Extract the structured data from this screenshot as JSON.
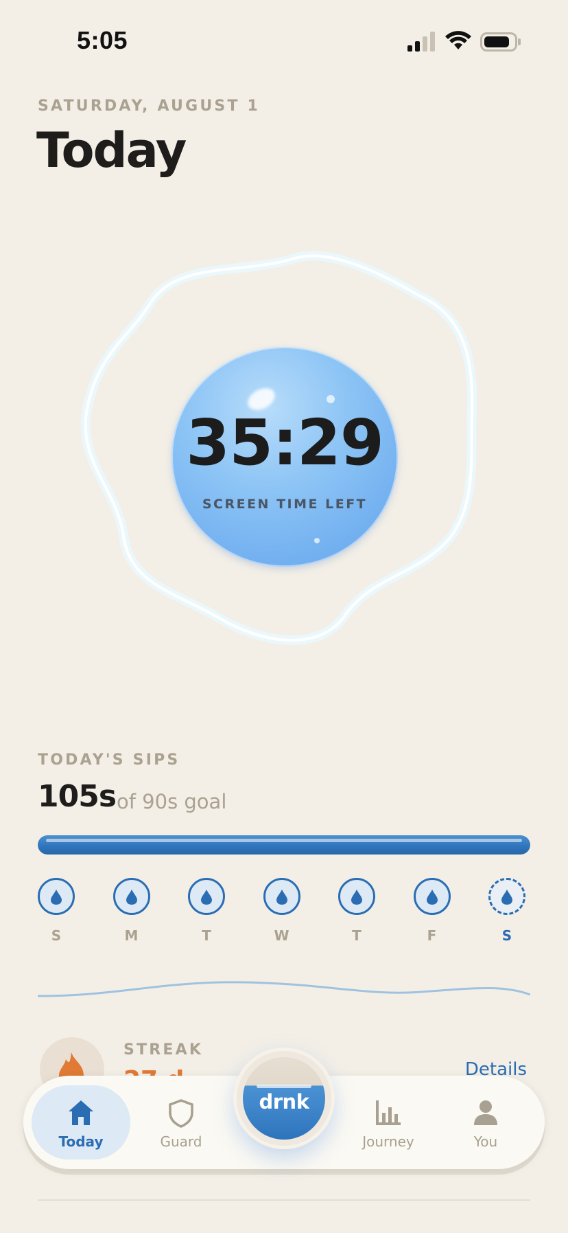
{
  "status_bar": {
    "time": "5:05"
  },
  "header": {
    "date": "SATURDAY, AUGUST 1",
    "title": "Today"
  },
  "timer": {
    "value": "35:29",
    "caption": "SCREEN TIME LEFT"
  },
  "sips": {
    "label": "TODAY'S SIPS",
    "value": "105s",
    "goal_text": "of 90s goal",
    "progress_fraction": 1.0
  },
  "week": [
    {
      "letter": "S",
      "state": "done"
    },
    {
      "letter": "M",
      "state": "done"
    },
    {
      "letter": "T",
      "state": "done"
    },
    {
      "letter": "W",
      "state": "done"
    },
    {
      "letter": "T",
      "state": "done"
    },
    {
      "letter": "F",
      "state": "done"
    },
    {
      "letter": "S",
      "state": "today"
    }
  ],
  "streak": {
    "label": "STREAK",
    "value": "27 d",
    "details_label": "Details"
  },
  "tab_bar": {
    "tabs": [
      {
        "label": "Today",
        "icon": "home-icon",
        "active": true
      },
      {
        "label": "Guard",
        "icon": "shield-icon",
        "active": false
      },
      {
        "label": "Journey",
        "icon": "bar-chart-icon",
        "active": false
      },
      {
        "label": "You",
        "icon": "person-icon",
        "active": false
      }
    ],
    "center_label": "drnk"
  },
  "colors": {
    "accent": "#2a6db3",
    "background": "#f3efe7",
    "streak": "#e07a35",
    "muted": "#aaa190"
  }
}
